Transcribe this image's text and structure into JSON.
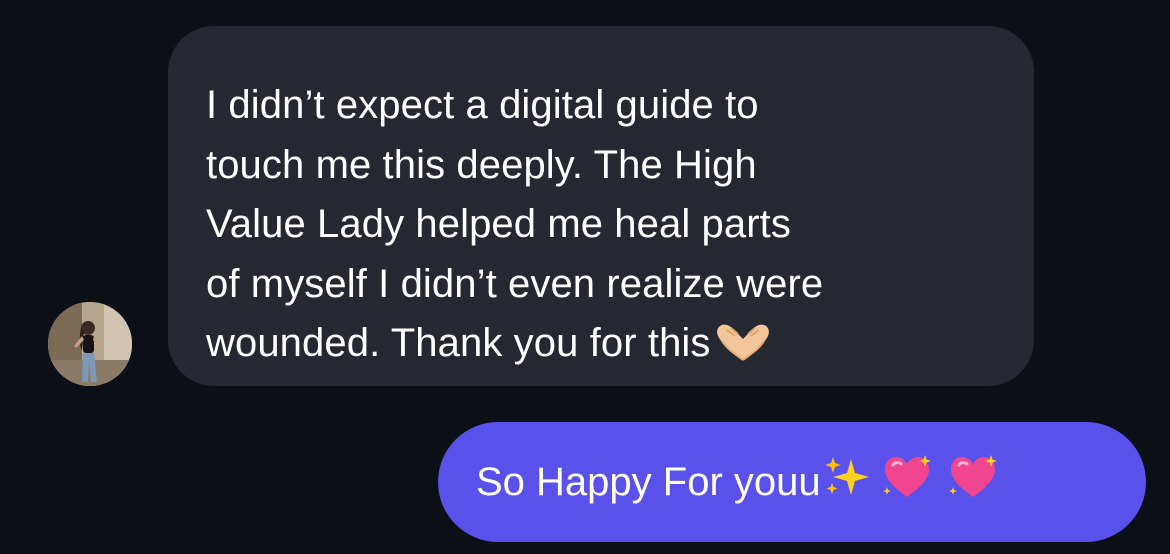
{
  "conversation": {
    "contact_avatar_icon": "avatar-photo",
    "incoming": {
      "lines": [
        "I didn’t expect a digital guide to",
        "touch me this deeply. The High",
        "Value Lady helped me heal parts",
        "of myself I didn’t even realize were",
        "wounded. Thank you for this"
      ],
      "emoji_icon": "heart-hands-icon",
      "bubble_color": "#252830"
    },
    "outgoing": {
      "text": "So Happy For youu",
      "emoji_icons": [
        "sparkles-icon",
        "sparkling-heart-icon",
        "sparkling-heart-icon"
      ],
      "bubble_color": "#5951ea"
    },
    "background_color": "#0c1016"
  }
}
